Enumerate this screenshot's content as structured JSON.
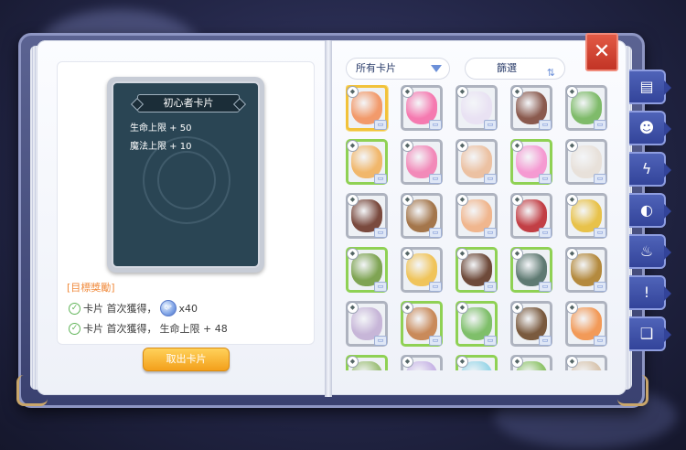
{
  "card_detail": {
    "name": "初心者卡片",
    "stats": [
      "生命上限 + 50",
      "魔法上限 + 10"
    ]
  },
  "rewards": {
    "title": "[目標獎勵]",
    "items": [
      {
        "text1": "卡片 首次獲得，",
        "has_gem": true,
        "gem_label": "QP",
        "text2": "x40"
      },
      {
        "text1": "卡片 首次獲得，",
        "has_gem": false,
        "text2": "生命上限 + 48"
      }
    ]
  },
  "take_button": "取出卡片",
  "filter_bar": {
    "category": "所有卡片",
    "filter": "篩選"
  },
  "close_label": "✕",
  "side_tabs": [
    {
      "icon": "card-stack-icon",
      "glyph": "▤"
    },
    {
      "icon": "poring-face-icon",
      "glyph": "☻"
    },
    {
      "icon": "claw-icon",
      "glyph": "ϟ"
    },
    {
      "icon": "fish-icon",
      "glyph": "◐"
    },
    {
      "icon": "chef-hat-icon",
      "glyph": "♨"
    },
    {
      "icon": "pin-icon",
      "glyph": "!"
    },
    {
      "icon": "open-book-icon",
      "glyph": "❑"
    }
  ],
  "cards": [
    {
      "color": "#f29a6b",
      "frame": "selected",
      "name": "novice-card"
    },
    {
      "color": "#f57ab0",
      "frame": "gray",
      "name": "poring-card"
    },
    {
      "color": "#e9e2f3",
      "frame": "gray",
      "name": "lunatic-card"
    },
    {
      "color": "#8a5a4e",
      "frame": "gray",
      "name": "fabre-card"
    },
    {
      "color": "#7fbb6a",
      "frame": "gray",
      "name": "pupa-card"
    },
    {
      "color": "#f1b76b",
      "frame": "green",
      "name": "drops-card"
    },
    {
      "color": "#f28ab9",
      "frame": "gray",
      "name": "poporing-card"
    },
    {
      "color": "#ecc1a2",
      "frame": "gray",
      "name": "spore-card"
    },
    {
      "color": "#f59ad2",
      "frame": "green",
      "name": "angeling-card"
    },
    {
      "color": "#e8e1da",
      "frame": "gray",
      "name": "savage-babe-card"
    },
    {
      "color": "#7a4a3e",
      "frame": "gray",
      "name": "rocker-card"
    },
    {
      "color": "#a4764b",
      "frame": "gray",
      "name": "willow-card"
    },
    {
      "color": "#f0b68e",
      "frame": "gray",
      "name": "thief-bug-egg-card"
    },
    {
      "color": "#c23f45",
      "frame": "gray",
      "name": "poison-spore-card"
    },
    {
      "color": "#e8c24a",
      "frame": "gray",
      "name": "ghostring-card"
    },
    {
      "color": "#7fa453",
      "frame": "green",
      "name": "thief-bug-card"
    },
    {
      "color": "#f0c45a",
      "frame": "gray",
      "name": "condor-card"
    },
    {
      "color": "#6e4a3a",
      "frame": "green",
      "name": "hornet-card"
    },
    {
      "color": "#5f7a72",
      "frame": "green",
      "name": "familiar-card"
    },
    {
      "color": "#b48a3e",
      "frame": "gray",
      "name": "ambernite-card"
    },
    {
      "color": "#c7b6d8",
      "frame": "gray",
      "name": "yoyo-card"
    },
    {
      "color": "#c98a5a",
      "frame": "green",
      "name": "mandragora-card"
    },
    {
      "color": "#7fbf6a",
      "frame": "green",
      "name": "elder-willow-card"
    },
    {
      "color": "#7a5a3e",
      "frame": "gray",
      "name": "orc-warrior-card"
    },
    {
      "color": "#f29a58",
      "frame": "gray",
      "name": "desert-wolf-card"
    },
    {
      "color": "#9fc07a",
      "frame": "green",
      "name": "card-26"
    },
    {
      "color": "#c9b6e6",
      "frame": "gray",
      "name": "card-27"
    },
    {
      "color": "#9bd7e8",
      "frame": "green",
      "name": "card-28"
    },
    {
      "color": "#8fc46a",
      "frame": "gray",
      "name": "card-29"
    },
    {
      "color": "#d9c6b0",
      "frame": "gray",
      "name": "card-30"
    }
  ]
}
